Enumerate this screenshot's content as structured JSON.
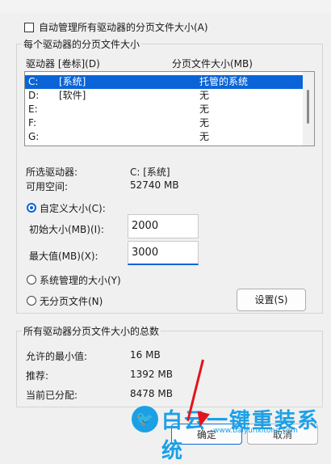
{
  "auto_manage": {
    "label": "自动管理所有驱动器的分页文件大小(A)",
    "checked": false
  },
  "per_drive_group": {
    "title": "每个驱动器的分页文件大小",
    "header_drive": "驱动器 [卷标](D)",
    "header_size": "分页文件大小(MB)",
    "rows": [
      {
        "drive": "C:",
        "label": "[系统]",
        "size": "托管的系统",
        "selected": true
      },
      {
        "drive": "D:",
        "label": "[软件]",
        "size": "无",
        "selected": false
      },
      {
        "drive": "E:",
        "label": "",
        "size": "无",
        "selected": false
      },
      {
        "drive": "F:",
        "label": "",
        "size": "无",
        "selected": false
      },
      {
        "drive": "G:",
        "label": "",
        "size": "无",
        "selected": false
      }
    ],
    "selected_drive_label": "所选驱动器:",
    "selected_drive_value": "C:  [系统]",
    "free_space_label": "可用空间:",
    "free_space_value": "52740 MB",
    "custom_size_label": "自定义大小(C):",
    "initial_size_label": "初始大小(MB)(I):",
    "initial_size_value": "2000",
    "max_size_label": "最大值(MB)(X):",
    "max_size_value": "3000",
    "system_managed_label": "系统管理的大小(Y)",
    "no_paging_label": "无分页文件(N)",
    "set_button": "设置(S)",
    "selected_option": "custom"
  },
  "total_group": {
    "title": "所有驱动器分页文件大小的总数",
    "min_label": "允许的最小值:",
    "min_value": "16 MB",
    "recommended_label": "推荐:",
    "recommended_value": "1392 MB",
    "current_label": "当前已分配:",
    "current_value": "8478 MB"
  },
  "buttons": {
    "ok": "确定",
    "cancel": "取消"
  },
  "watermark": {
    "logo": "🐦",
    "text": "白云一键重装系统",
    "url": "www.baiyunxitong.com"
  },
  "colors": {
    "accent": "#0a64d8",
    "watermark": "#1ba0e6",
    "arrow": "#e3141b"
  }
}
